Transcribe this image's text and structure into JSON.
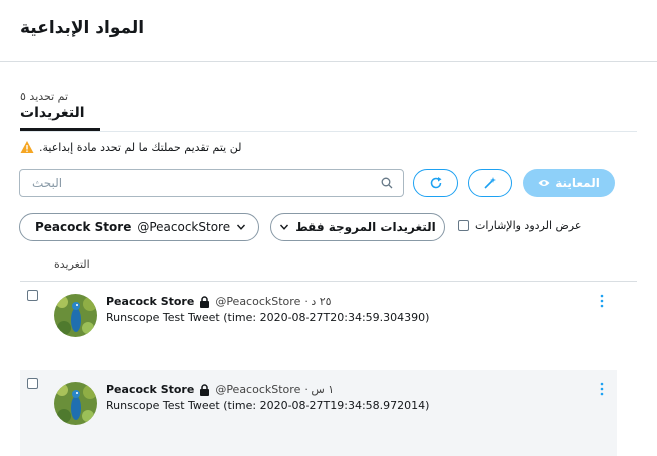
{
  "page": {
    "title": "المواد الإبداعية"
  },
  "tabs": [
    {
      "count_label": "تم تحديد ٥",
      "label": "التغريدات"
    }
  ],
  "warning": {
    "text": ".لن يتم تقديم حملتك ما لم تحدد مادة إبداعية"
  },
  "toolbar": {
    "search_placeholder": "البحث",
    "preview_label": "المعاينة"
  },
  "filters": {
    "account_name": "Peacock Store",
    "account_handle": "@PeacockStore",
    "tweet_type_label": "التغريدات المروجة فقط",
    "show_replies_label": "عرض الردود والإشارات",
    "show_replies_checked": false
  },
  "table": {
    "column_header": "التغريدة",
    "rows": [
      {
        "name": "Peacock Store",
        "handle": "@PeacockStore",
        "time": "٢٥ د ·",
        "text": "Runscope Test Tweet (time: 2020-08-27T20:34:59.304390)",
        "checked": false
      },
      {
        "name": "Peacock Store",
        "handle": "@PeacockStore",
        "time": "١ س ·",
        "text": "Runscope Test Tweet (time: 2020-08-27T19:34:58.972014)",
        "checked": false
      }
    ]
  },
  "colors": {
    "accent": "#1da1f2",
    "preview_button": "#8ed0f9",
    "warning": "#f5a623",
    "selected_row": "#f3f5f7"
  }
}
